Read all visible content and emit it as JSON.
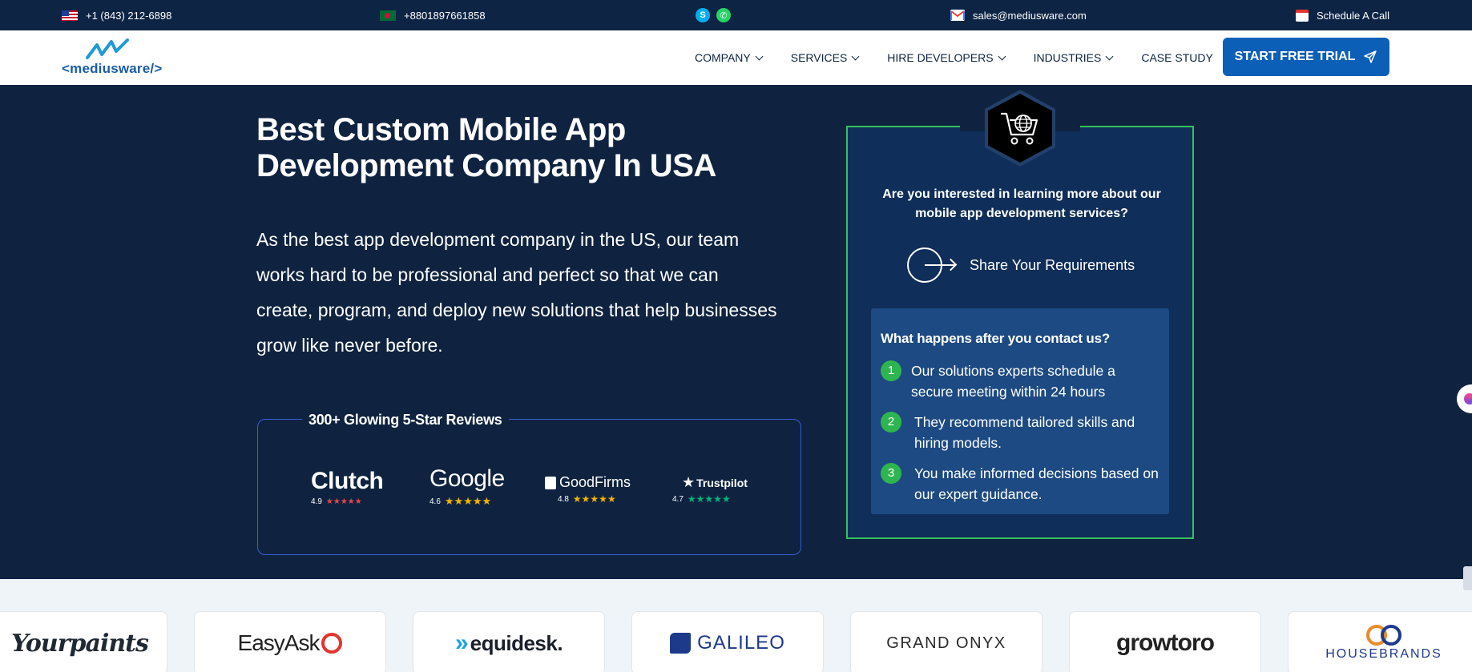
{
  "topbar": {
    "us_phone": "+1 (843) 212-6898",
    "bd_phone": "+8801897661858",
    "email": "sales@mediusware.com",
    "schedule": "Schedule A Call"
  },
  "brand": {
    "logo_text": "<mediusware/>"
  },
  "nav": {
    "items": [
      {
        "label": "COMPANY",
        "has_menu": true
      },
      {
        "label": "SERVICES",
        "has_menu": true
      },
      {
        "label": "HIRE DEVELOPERS",
        "has_menu": true
      },
      {
        "label": "INDUSTRIES",
        "has_menu": true
      },
      {
        "label": "CASE STUDY",
        "has_menu": false
      }
    ],
    "cta": "START FREE TRIAL"
  },
  "hero": {
    "title": "Best Custom Mobile App Development Company In USA",
    "lead": "As the best app development company in the US, our team works hard to be professional and perfect so that we can create, program, and deploy new solutions that help businesses grow like never before."
  },
  "reviews": {
    "title": "300+ Glowing 5-Star Reviews",
    "items": [
      {
        "brand": "Clutch",
        "rating": "4.9",
        "stars": "★★★★★",
        "star_color": "#e5484d"
      },
      {
        "brand": "Google",
        "rating": "4.6",
        "stars": "★★★★★",
        "star_color": "#f5b400"
      },
      {
        "brand": "GoodFirms",
        "rating": "4.8",
        "stars": "★★★★★",
        "star_color": "#f5b400"
      },
      {
        "brand": "Trustpilot",
        "rating": "4.7",
        "stars": "★★★★★",
        "star_color": "#00b67a"
      }
    ]
  },
  "card": {
    "question": "Are you interested in learning more about our mobile app development services?",
    "share": "Share Your Requirements",
    "steps_title": "What happens after you contact us?",
    "steps": [
      {
        "num": "1",
        "text": "Our solutions experts schedule a secure meeting within 24 hours"
      },
      {
        "num": "2",
        "text": "They recommend tailored skills and hiring models."
      },
      {
        "num": "3",
        "text": "You make informed decisions based on our expert guidance."
      }
    ]
  },
  "clients": [
    "Yourpaints",
    "EasyAsk",
    "equidesk.",
    "GALILEO",
    "GRAND ONYX",
    "growtoro",
    "HOUSEBRANDS"
  ],
  "colors": {
    "navy": "#0f2340",
    "accent_blue": "#0b5fb7",
    "green": "#35c15b"
  }
}
